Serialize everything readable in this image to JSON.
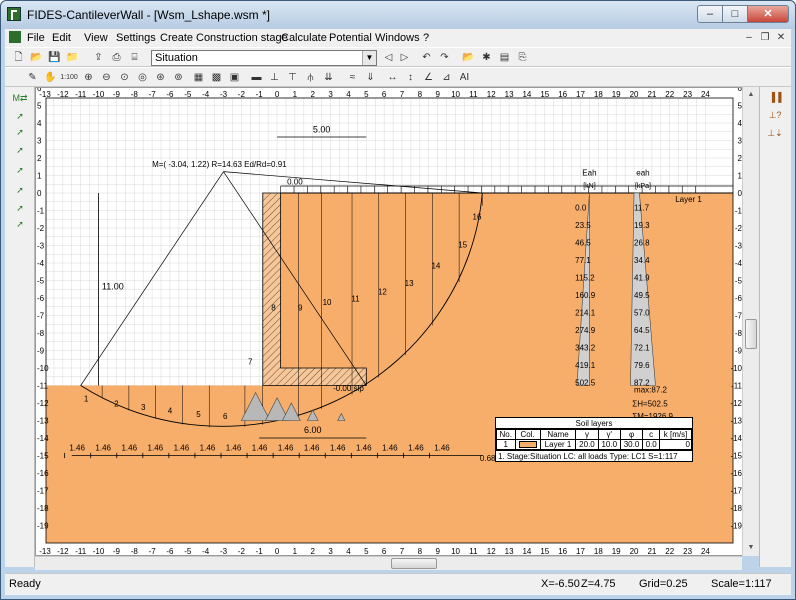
{
  "window": {
    "title": "FIDES-CantileverWall - [Wsm_Lshape.wsm *]"
  },
  "menu": [
    "File",
    "Edit",
    "View",
    "Settings",
    "Create",
    "Construction stage",
    "Calculate",
    "Potential",
    "Windows",
    "?"
  ],
  "toolbar": {
    "stage_value": "Situation",
    "scale_label": "1:100",
    "ai_label": "AI"
  },
  "statusbar": {
    "state": "Ready",
    "x": "X=-6.50",
    "z": "Z=4.75",
    "grid": "Grid=0.25",
    "scale": "Scale=1:117"
  },
  "drawing": {
    "x_ticks": [
      "-13",
      "-12",
      "-11",
      "-10",
      "-9",
      "-8",
      "-7",
      "-6",
      "-5",
      "-4",
      "-3",
      "-2",
      "-1",
      "0",
      "1",
      "2",
      "3",
      "4",
      "5",
      "6",
      "7",
      "8",
      "9",
      "10",
      "11",
      "12",
      "13",
      "14",
      "15",
      "16",
      "17",
      "18",
      "19",
      "20",
      "21",
      "22",
      "23",
      "24"
    ],
    "y_ticks": [
      "6",
      "5",
      "4",
      "3",
      "2",
      "1",
      "0",
      "-1",
      "-2",
      "-3",
      "-4",
      "-5",
      "-6",
      "-7",
      "-8",
      "-9",
      "-10",
      "-11",
      "-12",
      "-13",
      "-14",
      "-15",
      "-16",
      "-17",
      "-18",
      "-19"
    ],
    "moment_label": "M=( -3.04,  1.22) R=14.63  Ed/Rd=0.91",
    "dim_top": "5.00",
    "dim_height": "11.00",
    "dim_base": "6.00",
    "dim_top_load": "0.00",
    "base_level_label": "-0.00 slp",
    "layer_label": "Layer 1",
    "slice_labels": [
      "1",
      "2",
      "3",
      "4",
      "5",
      "6",
      "7",
      "8",
      "9",
      "10",
      "11",
      "12",
      "13",
      "14",
      "15",
      "16"
    ],
    "spacing_labels": [
      "1.46",
      "1.46",
      "1.46",
      "1.46",
      "1.46",
      "1.46",
      "1.46",
      "1.46",
      "1.46",
      "1.46",
      "1.46",
      "1.46",
      "1.46",
      "1.46",
      "1.46"
    ],
    "spacing_end": "0.68",
    "eah_title_1": "Eah",
    "eah_unit_1": "[kN]",
    "eah_title_2": "eah",
    "eah_unit_2": "[kPa]",
    "eah_values": [
      "0.0",
      "23.5",
      "46.5",
      "77.1",
      "115.2",
      "160.9",
      "214.1",
      "274.9",
      "343.2",
      "419.1",
      "502.5"
    ],
    "eah_kpa_values": [
      "11.7",
      "19.3",
      "26.8",
      "34.4",
      "41.9",
      "49.5",
      "57.0",
      "64.5",
      "72.1",
      "79.6",
      "87.2"
    ],
    "max_label": "max:87.2",
    "sum_h": "ΣH=502.5",
    "sum_m": "ΣM=1926.9"
  },
  "soil_table": {
    "title": "Soil layers",
    "headers": [
      "No.",
      "Col.",
      "Name",
      "γ",
      "γ'",
      "φ",
      "c",
      "k [m/s]"
    ],
    "rows": [
      [
        "1",
        "",
        "Layer 1",
        "20.0",
        "10.0",
        "30.0",
        "0.0",
        "0"
      ]
    ],
    "footer": "1. Stage:Situation LC:  all loads  Type: LC1 S=1:117"
  },
  "colors": {
    "soil": "#f7ae6b",
    "wall_hatch": "#d9894a",
    "grid": "#d8d8d8"
  }
}
